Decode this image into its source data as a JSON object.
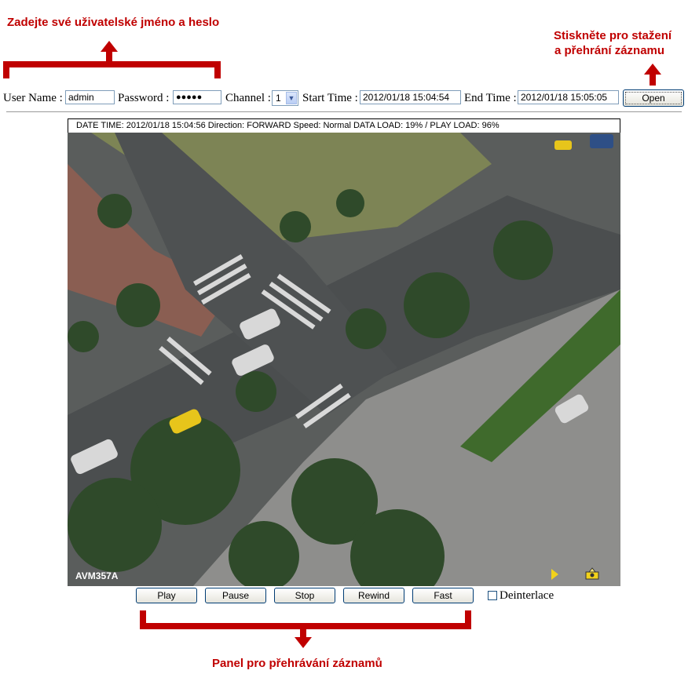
{
  "annotations": {
    "login_note": "Zadejte své uživatelské jméno a heslo",
    "open_note_line1": "Stiskněte pro stažení",
    "open_note_line2": "a přehrání záznamu",
    "panel_note": "Panel pro přehrávání záznamů",
    "color": "#c00000"
  },
  "toolbar": {
    "username_label": "User Name :",
    "username_value": "admin",
    "password_label": "Password :",
    "password_value": "●●●●●",
    "channel_label": "Channel :",
    "channel_value": "1",
    "start_label": "Start Time :",
    "start_value": "2012/01/18 15:04:54",
    "end_label": "End Time :",
    "end_value": "2012/01/18 15:05:05",
    "open_label": "Open"
  },
  "viewer": {
    "status_text": "DATE TIME: 2012/01/18 15:04:56    Direction: FORWARD  Speed: Normal  DATA LOAD: 19% / PLAY LOAD: 96%",
    "camera_label": "AVM357A",
    "play_indicator_icon": "play-icon",
    "snapshot_icon": "snapshot-icon"
  },
  "controls": {
    "play": "Play",
    "pause": "Pause",
    "stop": "Stop",
    "rewind": "Rewind",
    "fast": "Fast",
    "deinterlace_label": "Deinterlace",
    "deinterlace_checked": false
  }
}
